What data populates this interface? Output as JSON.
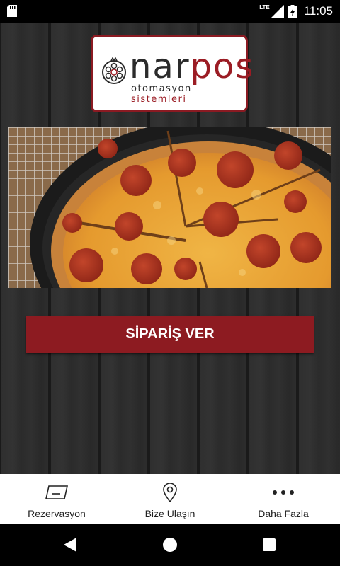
{
  "status_bar": {
    "time": "11:05",
    "network": "LTE",
    "icons": [
      "sd-card-icon",
      "signal-icon",
      "battery-icon"
    ]
  },
  "logo": {
    "brand_prefix": "nar",
    "brand_suffix": "pos",
    "tagline_left": "otomasyon",
    "tagline_right": "sistemleri",
    "colors": {
      "accent": "#9b1c24",
      "dark": "#2b2b2b"
    }
  },
  "banner": {
    "image_subject": "pepperoni-pizza-in-cast-iron-pan"
  },
  "order_button": {
    "label": "SİPARİŞ VER",
    "color": "#8d1b21"
  },
  "bottom_nav": {
    "items": [
      {
        "label": "Rezervasyon",
        "icon": "ticket-icon"
      },
      {
        "label": "Bize Ulaşın",
        "icon": "location-pin-icon"
      },
      {
        "label": "Daha Fazla",
        "icon": "more-dots-icon"
      }
    ]
  },
  "system_nav": {
    "buttons": [
      "back-icon",
      "home-icon",
      "recents-icon"
    ]
  }
}
